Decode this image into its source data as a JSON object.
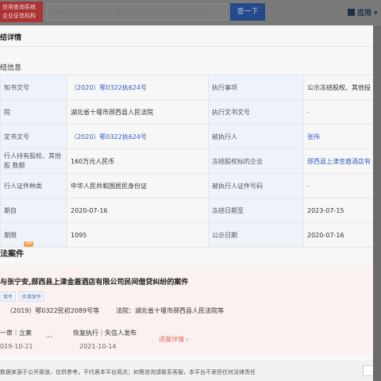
{
  "header": {
    "brand_line1": "信用查询系统",
    "brand_line2": "企业征信机构",
    "search_placeholder": "请输入企业名、人名、产品名、地址或电话/经营范围等",
    "search_button": "查一下",
    "apps_label": "应用"
  },
  "modal": {
    "title": "结详情",
    "section_title": "结信息",
    "rows": [
      [
        "知书文号",
        "（2020）鄂0322执624号",
        "执行事项",
        "公示冻结股权、其他投"
      ],
      [
        "院",
        "湖北省十堰市郧西县人民法院",
        "执行文书文号",
        "-"
      ],
      [
        "定书文号",
        "（2020）鄂0322执624号",
        "被执行人",
        "张伟"
      ],
      [
        "行人持有股权、其他股\n数额",
        "160万元人民币",
        "冻结股权标的企业",
        "郧西县上津金盾酒店有"
      ],
      [
        "行人证件种类",
        "中华人民共和国居民身份证",
        "被执行人证件号码",
        "-"
      ],
      [
        "期自",
        "2020-07-16",
        "冻结日期至",
        "2023-07-15"
      ],
      [
        "期限",
        "1095",
        "公示日期",
        "2020-07-16"
      ]
    ]
  },
  "judicial": {
    "title": "法案件",
    "vip": "VIP",
    "case_title": "与张宁安,郧西县上津金盾酒店有限公司民间借贷纠纷的案件",
    "tag1": "案件",
    "tag2": "民事案件",
    "case_no": "（2019）鄂0322民初2089号等",
    "court": "法院：湖北省十堰市郧西县人民法院等",
    "tl1_label": "一审｜立案",
    "tl1_date": "019-10-21",
    "ellipsis": "···",
    "tl2_label": "恢复执行｜失信人发布",
    "tl2_date": "2021-10-14",
    "progress": "进展详情 ›"
  },
  "footer_note": "数据来源于公开渠道，仅供参考，不代表本平台观点；如需咨询请联系客服，本平台不承担任何法律责任"
}
